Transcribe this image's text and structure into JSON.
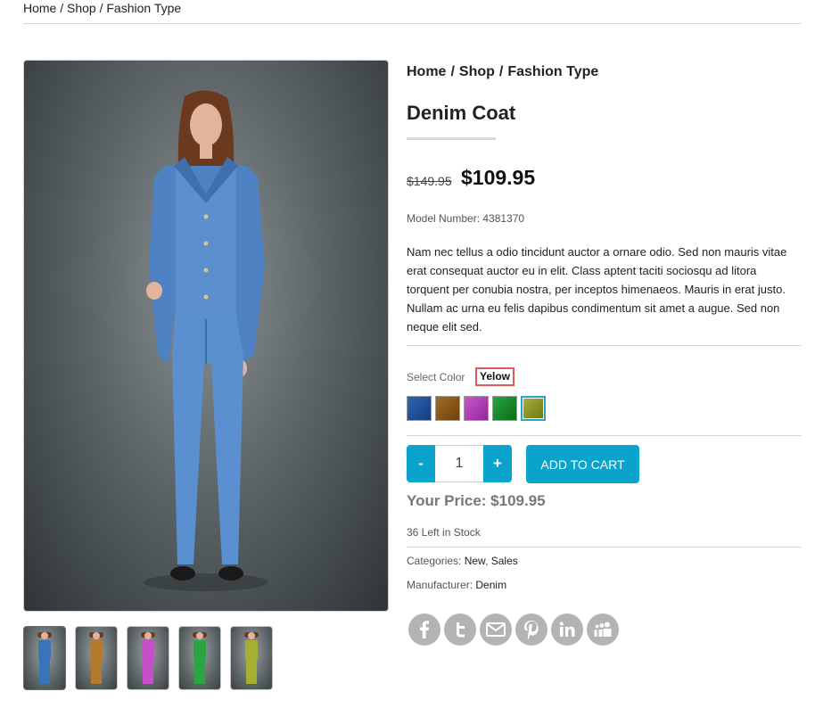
{
  "top_breadcrumb": "Home / Shop / Fashion Type",
  "breadcrumb": {
    "items": [
      "Home",
      "Shop",
      "Fashion Type"
    ],
    "separator": "/"
  },
  "product": {
    "title": "Denim Coat",
    "old_price": "$149.95",
    "price": "$109.95",
    "model_number": "Model Number: 4381370",
    "description": "Nam nec tellus a odio tincidunt auctor a ornare odio. Sed non mauris vitae erat consequat auctor eu in elit. Class aptent taciti sociosqu ad litora torquent per conubia nostra, per inceptos himenaeos. Mauris in erat justo. Nullam ac urna eu felis dapibus condimentum sit amet a augue. Sed non neque elit sed.",
    "select_color_label": "Select Color",
    "selected_color": "Yelow",
    "swatches": [
      {
        "name": "blue",
        "color": "#1f4f9c"
      },
      {
        "name": "brown",
        "color": "#8a5a1c"
      },
      {
        "name": "purple",
        "color": "#b23fb8"
      },
      {
        "name": "green",
        "color": "#1a8a2c"
      },
      {
        "name": "yellow",
        "color": "#8f9a22"
      }
    ],
    "quantity": "1",
    "minus_label": "-",
    "plus_label": "+",
    "add_to_cart": "ADD TO CART",
    "your_price": "Your Price: $109.95",
    "stock": "36 Left in Stock",
    "categories_label": "Categories:",
    "categories": [
      "New",
      "Sales"
    ],
    "manufacturer_label": "Manufacturer:",
    "manufacturer": "Denim"
  },
  "thumbnails": [
    {
      "name": "blue",
      "color": "#3b73b8"
    },
    {
      "name": "brown",
      "color": "#b57a2c"
    },
    {
      "name": "purple",
      "color": "#c74fc9"
    },
    {
      "name": "green",
      "color": "#2aa53f"
    },
    {
      "name": "yellow",
      "color": "#a5b030"
    }
  ],
  "social": [
    "facebook-icon",
    "twitter-icon",
    "email-icon",
    "pinterest-icon",
    "linkedin-icon",
    "myspace-icon"
  ],
  "colors": {
    "accent": "#0aa3cc",
    "social_grey": "#b3b3b3",
    "highlight_border": "#e05a5a"
  }
}
